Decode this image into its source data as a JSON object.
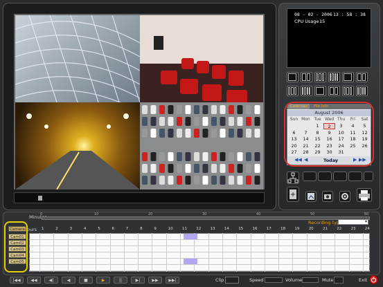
{
  "status": {
    "date": "08 - 02 - 2006",
    "time": "13 : 58 : 38",
    "cpu_label": "CPU Usage :",
    "cpu_value": "15"
  },
  "calendar": {
    "tabs": [
      "Calendar",
      "File Info"
    ],
    "month_year": "August  2006",
    "weekdays": [
      "Sun",
      "Mon",
      "Tue",
      "Wed",
      "Thu",
      "Fri",
      "Sat"
    ],
    "weeks": [
      [
        "",
        "",
        "1",
        "2",
        "3",
        "4",
        "5"
      ],
      [
        "6",
        "7",
        "8",
        "9",
        "10",
        "11",
        "12"
      ],
      [
        "13",
        "14",
        "15",
        "16",
        "17",
        "18",
        "19"
      ],
      [
        "20",
        "21",
        "22",
        "23",
        "24",
        "25",
        "26"
      ],
      [
        "27",
        "28",
        "29",
        "30",
        "31",
        "",
        ""
      ]
    ],
    "selected_day": "2",
    "today_label": "Today"
  },
  "timeline": {
    "minutes_label": "Minutes",
    "hours_label": "Hours",
    "recording_type_label": "Recording type",
    "camera_header": "Camera",
    "cameras": [
      "Cam01",
      "Cam02",
      "Cam03",
      "Cam04",
      "Cam05"
    ],
    "hours": [
      "1",
      "2",
      "3",
      "4",
      "5",
      "6",
      "7",
      "8",
      "9",
      "10",
      "11",
      "12",
      "13",
      "14",
      "15",
      "16",
      "17",
      "18",
      "19",
      "20",
      "21",
      "22",
      "23",
      "24"
    ],
    "minute_ticks": [
      "0",
      "10",
      "20",
      "30",
      "40",
      "50",
      "60"
    ]
  },
  "bottombar": {
    "clip_label": "Clip",
    "speed_label": "Speed",
    "volume_label": "Volume",
    "mute_label": "Mute",
    "exit_label": "Exit"
  },
  "colors": {
    "accent_red": "#d43030",
    "highlight_yellow": "#e8d000",
    "recording_mark": "#b0a8f0"
  }
}
